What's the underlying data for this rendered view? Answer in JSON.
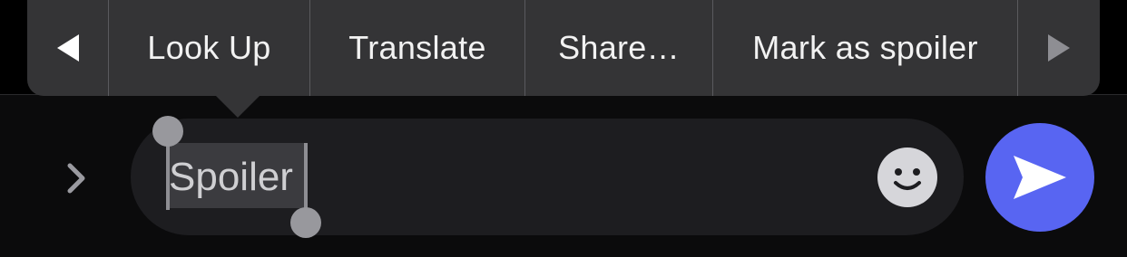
{
  "context_menu": {
    "items": [
      {
        "label": "Look Up"
      },
      {
        "label": "Translate"
      },
      {
        "label": "Share…"
      },
      {
        "label": "Mark as spoiler"
      }
    ],
    "prev_icon": "triangle-left-icon",
    "next_icon": "triangle-right-icon",
    "next_enabled": false
  },
  "composer": {
    "expand_icon": "chevron-right-icon",
    "input_value": "Spoiler",
    "selected_text": "Spoiler",
    "emoji_icon": "smiley-face-icon",
    "send_icon": "paper-plane-icon"
  },
  "colors": {
    "menu_background": "#343436",
    "send_button": "#5865f2",
    "input_background": "#1d1d20"
  }
}
